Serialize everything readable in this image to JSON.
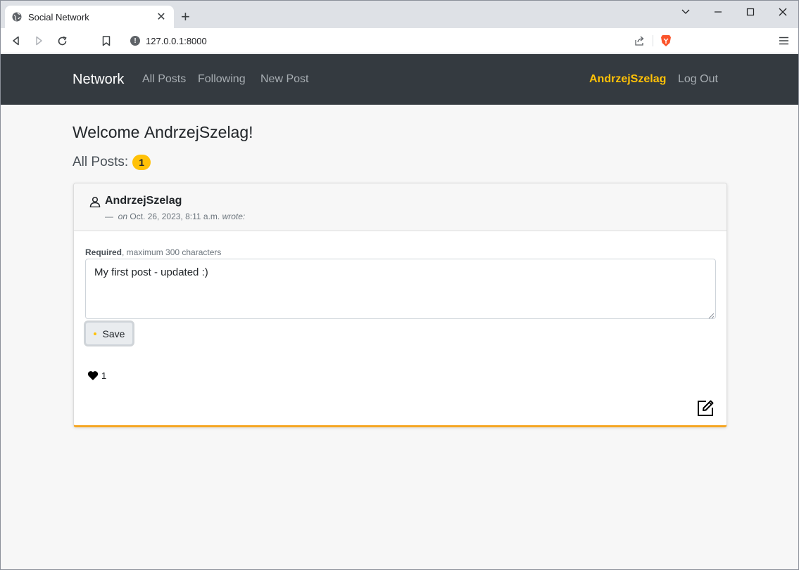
{
  "browser": {
    "tab_title": "Social Network",
    "url": "127.0.0.1:8000",
    "icons": {
      "tab_favicon": "globe-icon",
      "tab_close": "close-icon",
      "new_tab": "plus-icon",
      "back": "back-icon",
      "forward": "forward-icon",
      "reload": "reload-icon",
      "bookmark": "bookmark-icon",
      "site_info": "info-icon",
      "share": "share-icon",
      "brave": "brave-shield-icon",
      "menu": "hamburger-menu-icon",
      "tab_list": "chevron-down-icon",
      "minimize": "minimize-icon",
      "maximize": "maximize-icon",
      "close_window": "close-icon"
    }
  },
  "nav": {
    "brand": "Network",
    "links": [
      "All Posts",
      "Following",
      "New Post"
    ],
    "username": "AndrzejSzelag",
    "logout": "Log Out",
    "accent_color": "#ffc107",
    "background": "#343a40"
  },
  "main": {
    "welcome_prefix": "Welcome ",
    "welcome_name": "AndrzejSzelag",
    "welcome_suffix": "!",
    "all_posts_label": "All Posts:",
    "post_count": "1"
  },
  "post": {
    "author": "AndrzejSzelag",
    "dash": "—",
    "date_prefix": "on",
    "date": "Oct. 26, 2023, 8:11 a.m.",
    "wrote": "wrote:",
    "hint_required": "Required",
    "hint_rest": ", maximum 300 characters",
    "content": "My first post - updated :)",
    "save_label": "Save",
    "likes": "1",
    "card_accent": "#f5a623"
  }
}
